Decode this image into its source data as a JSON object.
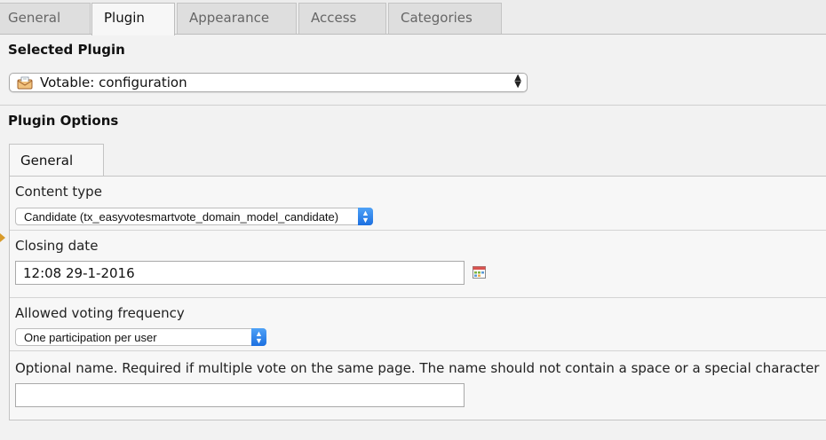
{
  "top_tabs": [
    "General",
    "Plugin",
    "Appearance",
    "Access",
    "Categories"
  ],
  "active_tab": "Plugin",
  "selected_plugin": {
    "title": "Selected Plugin",
    "value": "Votable: configuration"
  },
  "plugin_options": {
    "title": "Plugin Options",
    "tab_label": "General",
    "content_type": {
      "label": "Content type",
      "value": "Candidate (tx_easyvotesmartvote_domain_model_candidate)"
    },
    "closing_date": {
      "label": "Closing date",
      "value": "12:08 29-1-2016"
    },
    "voting_frequency": {
      "label": "Allowed voting frequency",
      "value": "One participation per user"
    },
    "optional_name": {
      "label": "Optional name. Required if multiple vote on the same page. The name should not contain a space or a special character",
      "value": ""
    }
  },
  "colors": {
    "accent": "#1c6fe0",
    "marker": "#d89a2a"
  },
  "icons": [
    "plugin-envelope-icon",
    "calendar-icon",
    "select-arrows-icon",
    "field-marker-icon"
  ]
}
